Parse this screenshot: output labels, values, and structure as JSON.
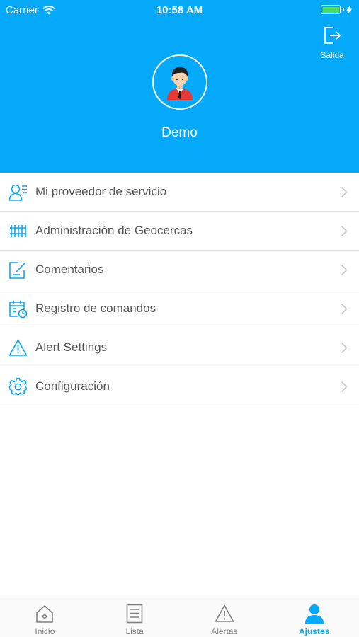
{
  "status_bar": {
    "carrier": "Carrier",
    "time": "10:58 AM",
    "battery_level": 1.0
  },
  "header": {
    "logout_label": "Salida",
    "logout_icon": "logout-icon",
    "user_name": "Demo",
    "avatar_icon": "user-avatar-icon",
    "background_color": "#05a9fa"
  },
  "menu": {
    "items": [
      {
        "label": "Mi proveedor de servicio",
        "icon": "service-provider-icon"
      },
      {
        "label": "Administración de Geocercas",
        "icon": "geofence-icon"
      },
      {
        "label": "Comentarios",
        "icon": "feedback-icon"
      },
      {
        "label": "Registro de comandos",
        "icon": "command-log-icon"
      },
      {
        "label": "Alert Settings",
        "icon": "alert-icon"
      },
      {
        "label": "Configuración",
        "icon": "gear-icon"
      }
    ]
  },
  "tabbar": {
    "tabs": [
      {
        "label": "Inicio",
        "icon": "home-icon",
        "active": false
      },
      {
        "label": "Lista",
        "icon": "list-icon",
        "active": false
      },
      {
        "label": "Alertas",
        "icon": "warning-icon",
        "active": false
      },
      {
        "label": "Ajustes",
        "icon": "person-icon",
        "active": true
      }
    ],
    "active_color": "#05a9fa",
    "inactive_color": "#808080"
  }
}
